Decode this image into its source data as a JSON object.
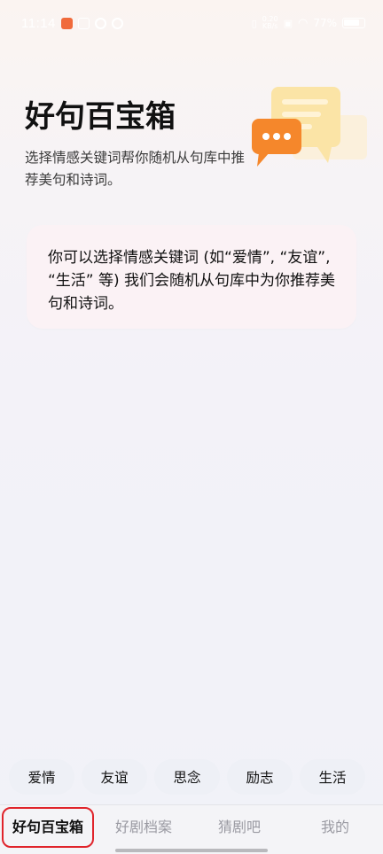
{
  "status_bar": {
    "time": "11:14",
    "net_speed_top": "0.20",
    "net_speed_unit": "KB/s",
    "battery": "77%"
  },
  "header": {
    "title": "好句百宝箱",
    "subtitle": "选择情感关键词帮你随机从句库中推荐美句和诗词。"
  },
  "info_card": {
    "text": "你可以选择情感关键词 (如“爱情”, “友谊”, “生活” 等) 我们会随机从句库中为你推荐美句和诗词。"
  },
  "keywords": [
    "爱情",
    "友谊",
    "思念",
    "励志",
    "生活"
  ],
  "nav": {
    "items": [
      "好句百宝箱",
      "好剧档案",
      "猜剧吧",
      "我的"
    ],
    "active_index": 0
  },
  "colors": {
    "active_ring": "#e0242b",
    "illustration_orange": "#f5872b",
    "illustration_yellow": "#fbe4a6"
  }
}
